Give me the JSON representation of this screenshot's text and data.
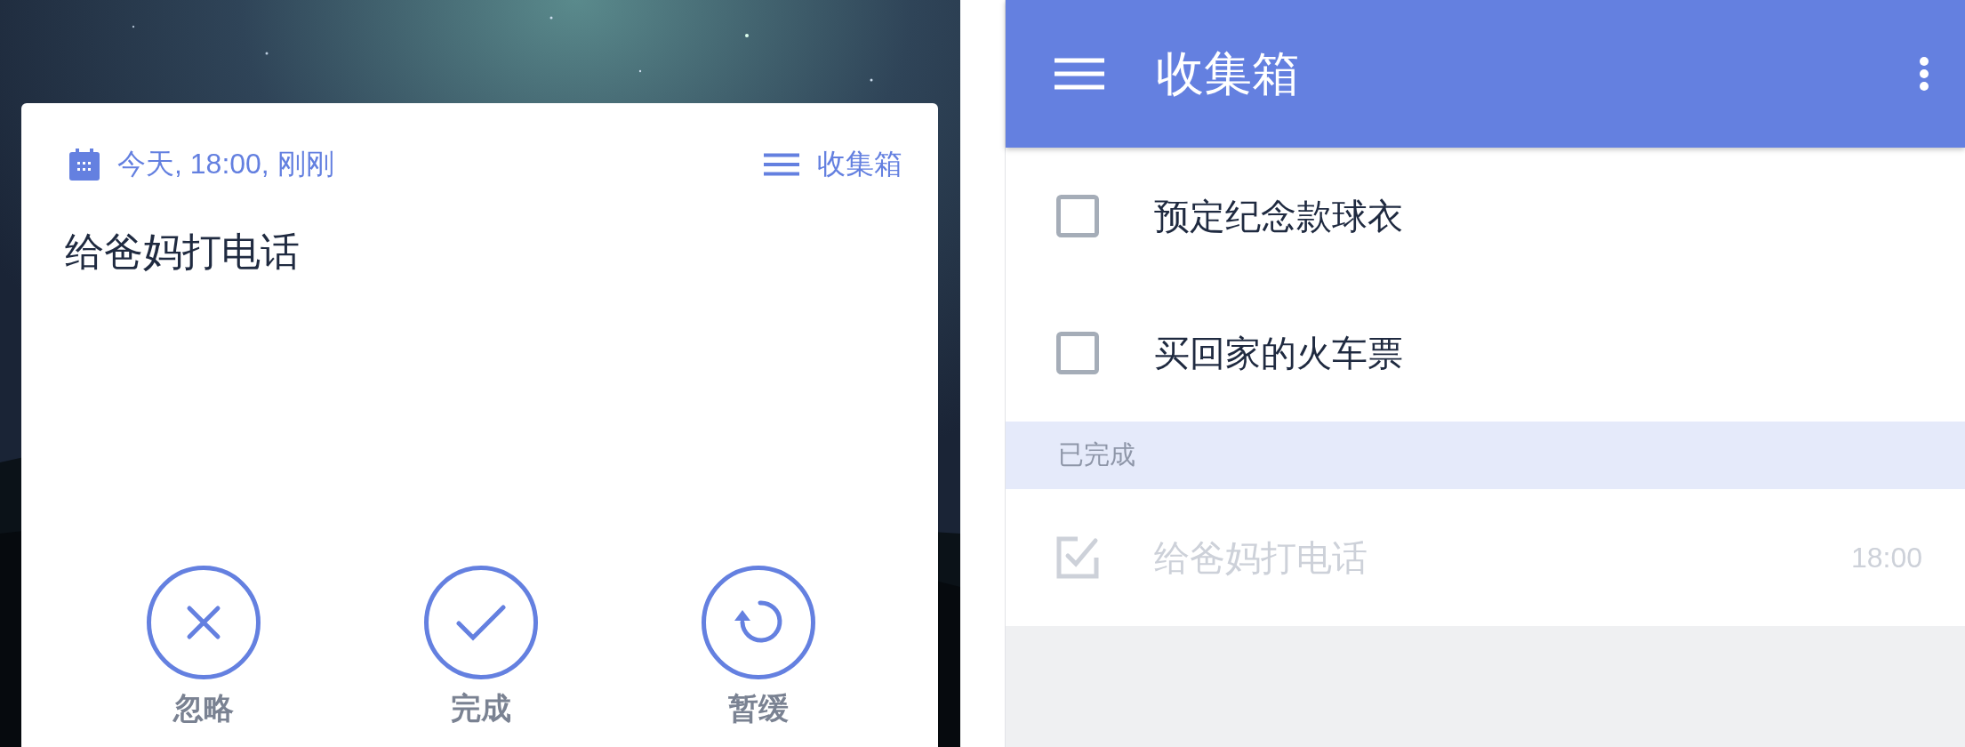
{
  "reminder": {
    "date_label": "今天, 18:00, 刚刚",
    "list_label": "收集箱",
    "title": "给爸妈打电话",
    "actions": [
      {
        "kind": "dismiss",
        "label": "忽略"
      },
      {
        "kind": "complete",
        "label": "完成"
      },
      {
        "kind": "snooze",
        "label": "暂缓"
      }
    ]
  },
  "inbox": {
    "title": "收集箱",
    "tasks": [
      {
        "title": "预定纪念款球衣",
        "checked": false
      },
      {
        "title": "买回家的火车票",
        "checked": false
      }
    ],
    "completed_header": "已完成",
    "completed": [
      {
        "title": "给爸妈打电话",
        "checked": true,
        "time": "18:00"
      }
    ]
  }
}
